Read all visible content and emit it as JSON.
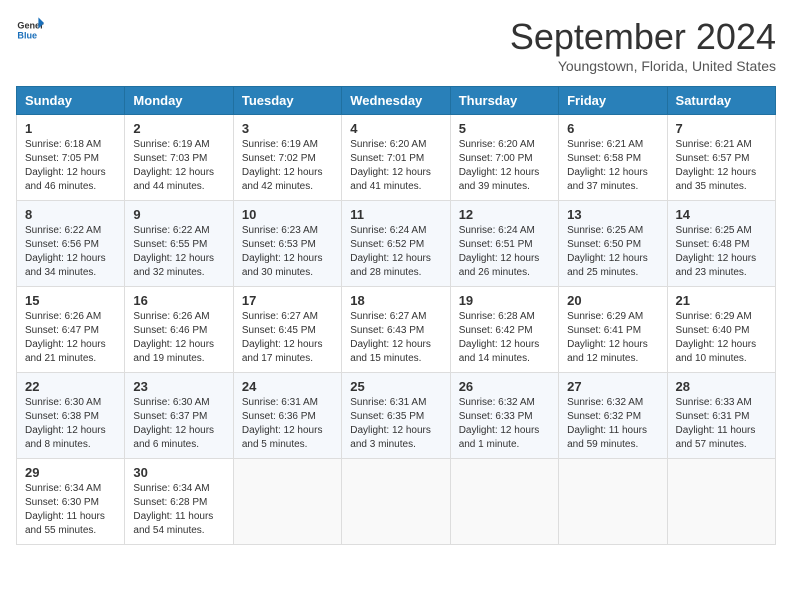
{
  "header": {
    "logo_general": "General",
    "logo_blue": "Blue",
    "title": "September 2024",
    "location": "Youngstown, Florida, United States"
  },
  "days_of_week": [
    "Sunday",
    "Monday",
    "Tuesday",
    "Wednesday",
    "Thursday",
    "Friday",
    "Saturday"
  ],
  "weeks": [
    [
      {
        "day": "1",
        "sunrise": "6:18 AM",
        "sunset": "7:05 PM",
        "daylight": "12 hours and 46 minutes."
      },
      {
        "day": "2",
        "sunrise": "6:19 AM",
        "sunset": "7:03 PM",
        "daylight": "12 hours and 44 minutes."
      },
      {
        "day": "3",
        "sunrise": "6:19 AM",
        "sunset": "7:02 PM",
        "daylight": "12 hours and 42 minutes."
      },
      {
        "day": "4",
        "sunrise": "6:20 AM",
        "sunset": "7:01 PM",
        "daylight": "12 hours and 41 minutes."
      },
      {
        "day": "5",
        "sunrise": "6:20 AM",
        "sunset": "7:00 PM",
        "daylight": "12 hours and 39 minutes."
      },
      {
        "day": "6",
        "sunrise": "6:21 AM",
        "sunset": "6:58 PM",
        "daylight": "12 hours and 37 minutes."
      },
      {
        "day": "7",
        "sunrise": "6:21 AM",
        "sunset": "6:57 PM",
        "daylight": "12 hours and 35 minutes."
      }
    ],
    [
      {
        "day": "8",
        "sunrise": "6:22 AM",
        "sunset": "6:56 PM",
        "daylight": "12 hours and 34 minutes."
      },
      {
        "day": "9",
        "sunrise": "6:22 AM",
        "sunset": "6:55 PM",
        "daylight": "12 hours and 32 minutes."
      },
      {
        "day": "10",
        "sunrise": "6:23 AM",
        "sunset": "6:53 PM",
        "daylight": "12 hours and 30 minutes."
      },
      {
        "day": "11",
        "sunrise": "6:24 AM",
        "sunset": "6:52 PM",
        "daylight": "12 hours and 28 minutes."
      },
      {
        "day": "12",
        "sunrise": "6:24 AM",
        "sunset": "6:51 PM",
        "daylight": "12 hours and 26 minutes."
      },
      {
        "day": "13",
        "sunrise": "6:25 AM",
        "sunset": "6:50 PM",
        "daylight": "12 hours and 25 minutes."
      },
      {
        "day": "14",
        "sunrise": "6:25 AM",
        "sunset": "6:48 PM",
        "daylight": "12 hours and 23 minutes."
      }
    ],
    [
      {
        "day": "15",
        "sunrise": "6:26 AM",
        "sunset": "6:47 PM",
        "daylight": "12 hours and 21 minutes."
      },
      {
        "day": "16",
        "sunrise": "6:26 AM",
        "sunset": "6:46 PM",
        "daylight": "12 hours and 19 minutes."
      },
      {
        "day": "17",
        "sunrise": "6:27 AM",
        "sunset": "6:45 PM",
        "daylight": "12 hours and 17 minutes."
      },
      {
        "day": "18",
        "sunrise": "6:27 AM",
        "sunset": "6:43 PM",
        "daylight": "12 hours and 15 minutes."
      },
      {
        "day": "19",
        "sunrise": "6:28 AM",
        "sunset": "6:42 PM",
        "daylight": "12 hours and 14 minutes."
      },
      {
        "day": "20",
        "sunrise": "6:29 AM",
        "sunset": "6:41 PM",
        "daylight": "12 hours and 12 minutes."
      },
      {
        "day": "21",
        "sunrise": "6:29 AM",
        "sunset": "6:40 PM",
        "daylight": "12 hours and 10 minutes."
      }
    ],
    [
      {
        "day": "22",
        "sunrise": "6:30 AM",
        "sunset": "6:38 PM",
        "daylight": "12 hours and 8 minutes."
      },
      {
        "day": "23",
        "sunrise": "6:30 AM",
        "sunset": "6:37 PM",
        "daylight": "12 hours and 6 minutes."
      },
      {
        "day": "24",
        "sunrise": "6:31 AM",
        "sunset": "6:36 PM",
        "daylight": "12 hours and 5 minutes."
      },
      {
        "day": "25",
        "sunrise": "6:31 AM",
        "sunset": "6:35 PM",
        "daylight": "12 hours and 3 minutes."
      },
      {
        "day": "26",
        "sunrise": "6:32 AM",
        "sunset": "6:33 PM",
        "daylight": "12 hours and 1 minute."
      },
      {
        "day": "27",
        "sunrise": "6:32 AM",
        "sunset": "6:32 PM",
        "daylight": "11 hours and 59 minutes."
      },
      {
        "day": "28",
        "sunrise": "6:33 AM",
        "sunset": "6:31 PM",
        "daylight": "11 hours and 57 minutes."
      }
    ],
    [
      {
        "day": "29",
        "sunrise": "6:34 AM",
        "sunset": "6:30 PM",
        "daylight": "11 hours and 55 minutes."
      },
      {
        "day": "30",
        "sunrise": "6:34 AM",
        "sunset": "6:28 PM",
        "daylight": "11 hours and 54 minutes."
      },
      null,
      null,
      null,
      null,
      null
    ]
  ]
}
